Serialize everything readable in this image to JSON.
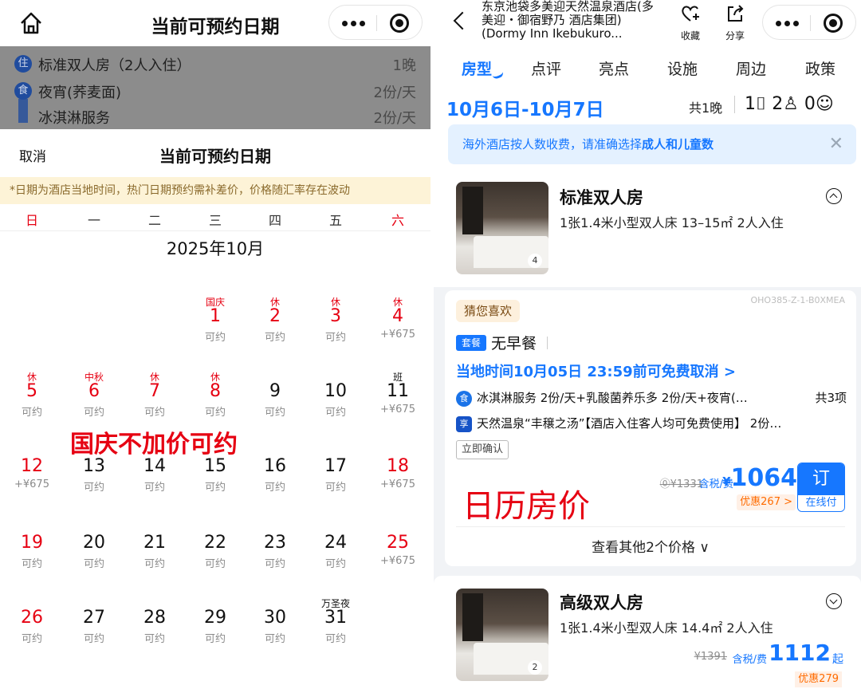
{
  "left": {
    "header_title": "当前可预约日期",
    "dimmed_items": [
      {
        "badge": "住",
        "label": "标准双人房（2人入住）",
        "value": "1晚"
      },
      {
        "badge": "食",
        "label": "夜宵(荞麦面)",
        "value": "2份/天"
      },
      {
        "badge": "",
        "label": "冰淇淋服务",
        "value": "2份/天"
      }
    ],
    "sheet": {
      "cancel": "取消",
      "title": "当前可预约日期",
      "notice": "*日期为酒店当地时间，热门日期预约需补差价，价格随汇率存在波动",
      "weekdays": [
        "日",
        "一",
        "二",
        "三",
        "四",
        "五",
        "六"
      ],
      "month": "2025年10月",
      "overlay_text": "国庆不加价可约",
      "days": [
        {
          "tag": "国庆",
          "num": "1",
          "sub": "可约",
          "red": true
        },
        {
          "tag": "休",
          "num": "2",
          "sub": "可约",
          "red": true
        },
        {
          "tag": "休",
          "num": "3",
          "sub": "可约",
          "red": true
        },
        {
          "tag": "休",
          "num": "4",
          "sub": "+¥675",
          "red": true
        },
        {
          "tag": "休",
          "num": "5",
          "sub": "可约",
          "red": true
        },
        {
          "tag": "中秋",
          "num": "6",
          "sub": "可约",
          "red": true
        },
        {
          "tag": "休",
          "num": "7",
          "sub": "可约",
          "red": true
        },
        {
          "tag": "休",
          "num": "8",
          "sub": "可约",
          "red": true
        },
        {
          "tag": "",
          "num": "9",
          "sub": "可约",
          "red": false
        },
        {
          "tag": "",
          "num": "10",
          "sub": "可约",
          "red": false
        },
        {
          "tag": "班",
          "num": "11",
          "sub": "+¥675",
          "red": false,
          "tag_black": true
        },
        {
          "tag": "",
          "num": "12",
          "sub": "+¥675",
          "red": true
        },
        {
          "tag": "",
          "num": "13",
          "sub": "可约",
          "red": false
        },
        {
          "tag": "",
          "num": "14",
          "sub": "可约",
          "red": false
        },
        {
          "tag": "",
          "num": "15",
          "sub": "可约",
          "red": false
        },
        {
          "tag": "",
          "num": "16",
          "sub": "可约",
          "red": false
        },
        {
          "tag": "",
          "num": "17",
          "sub": "可约",
          "red": false
        },
        {
          "tag": "",
          "num": "18",
          "sub": "+¥675",
          "red": true
        },
        {
          "tag": "",
          "num": "19",
          "sub": "可约",
          "red": true
        },
        {
          "tag": "",
          "num": "20",
          "sub": "可约",
          "red": false
        },
        {
          "tag": "",
          "num": "21",
          "sub": "可约",
          "red": false
        },
        {
          "tag": "",
          "num": "22",
          "sub": "可约",
          "red": false
        },
        {
          "tag": "",
          "num": "23",
          "sub": "可约",
          "red": false
        },
        {
          "tag": "",
          "num": "24",
          "sub": "可约",
          "red": false
        },
        {
          "tag": "",
          "num": "25",
          "sub": "+¥675",
          "red": true
        },
        {
          "tag": "",
          "num": "26",
          "sub": "可约",
          "red": true
        },
        {
          "tag": "",
          "num": "27",
          "sub": "可约",
          "red": false
        },
        {
          "tag": "",
          "num": "28",
          "sub": "可约",
          "red": false
        },
        {
          "tag": "",
          "num": "29",
          "sub": "可约",
          "red": false
        },
        {
          "tag": "",
          "num": "30",
          "sub": "可约",
          "red": false
        },
        {
          "tag": "万圣夜",
          "num": "31",
          "sub": "可约",
          "red": false,
          "tag_black": true
        }
      ]
    }
  },
  "right": {
    "hotel_title": "东京池袋多美迎天然温泉酒店(多美迎・御宿野乃 酒店集团)(Dormy Inn Ikebukuro...",
    "fav_label": "收藏",
    "share_label": "分享",
    "tabs": [
      "房型",
      "点评",
      "亮点",
      "设施",
      "周边",
      "政策"
    ],
    "date_range": "10月6日-10月7日",
    "nights": "共1晚",
    "guests": "1⌷ 2♙ 0☺",
    "info_text_pre": "海外酒店按人数收费，请准确选择",
    "info_text_bold": "成人和儿童数",
    "rooms": [
      {
        "name": "标准双人房",
        "desc": "1张1.4米小型双人床 13–15㎡ 2人入住",
        "photo_count": "4"
      },
      {
        "name": "高级双人房",
        "desc": "1张1.4米小型双人床 14.4㎡ 2人入住",
        "photo_count": "2",
        "old_price": "¥1391",
        "tax_label": "含税/费",
        "price": "1112",
        "price_suffix": "起",
        "discount": "优惠279"
      }
    ],
    "offer": {
      "code": "OHO385-Z-1-B0XMEA",
      "guess": "猜您喜欢",
      "pkg": "套餐",
      "meal": "无早餐",
      "cancel_policy": "当地时间10月05日 23:59前可免费取消 >",
      "perk1_icon": "食",
      "perk1": "冰淇淋服务 2份/天+乳酸菌养乐多 2份/天+夜宵(…",
      "perk1_count": "共3项",
      "perk2_icon": "享",
      "perk2": "天然温泉“丰穣之汤”【酒店入住客人均可免费使用】 2份…",
      "confirm": "立即确认",
      "overlay_text": "日历房价",
      "old_price": "⓪¥1331",
      "tax_label": "含税/费",
      "currency": "¥",
      "price": "1064",
      "discount": "优惠267 >",
      "book_top": "订",
      "book_bottom": "在线付",
      "more_prices": "查看其他2个价格 ∨"
    }
  }
}
